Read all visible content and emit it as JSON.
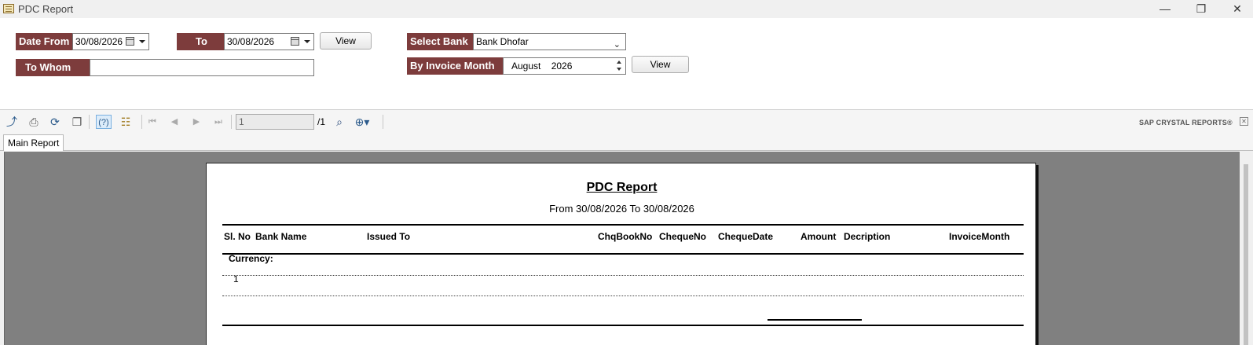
{
  "window": {
    "title": "PDC Report",
    "minimize_glyph": "—",
    "maximize_glyph": "❐",
    "close_glyph": "✕"
  },
  "filters": {
    "date_from_label": "Date From",
    "date_from_value": "30/08/2026",
    "to_label": "To",
    "to_value": "30/08/2026",
    "view_label": "View",
    "select_bank_label": "Select Bank",
    "select_bank_value": "Bank Dhofar",
    "to_whom_label": "To Whom",
    "to_whom_value": "",
    "invoice_month_label": "By Invoice Month",
    "invoice_month_value": "August",
    "invoice_year_value": "2026",
    "view2_label": "View"
  },
  "viewer": {
    "page_input": "1",
    "page_total": "/1",
    "brand": "SAP CRYSTAL REPORTS®",
    "tab_label": "Main Report",
    "icons": [
      "export-icon",
      "print-icon",
      "refresh-icon",
      "copy-icon",
      "help-icon",
      "group-tree-icon",
      "first-page-icon",
      "prev-page-icon",
      "next-page-icon",
      "last-page-icon",
      "find-icon",
      "zoom-icon"
    ]
  },
  "report": {
    "title": "PDC Report",
    "subtitle": "From 30/08/2026 To 30/08/2026",
    "columns": [
      "Sl. No",
      "Bank Name",
      "Issued To",
      "ChqBookNo",
      "ChequeNo",
      "ChequeDate",
      "Amount",
      "Decription",
      "InvoiceMonth"
    ],
    "currency_label": "Currency:",
    "rows": [
      {
        "sl_no": "1"
      }
    ]
  },
  "colors": {
    "label_bg": "#7d3c3c",
    "report_bg": "#808080",
    "icon_blue": "#2c5b8c"
  }
}
